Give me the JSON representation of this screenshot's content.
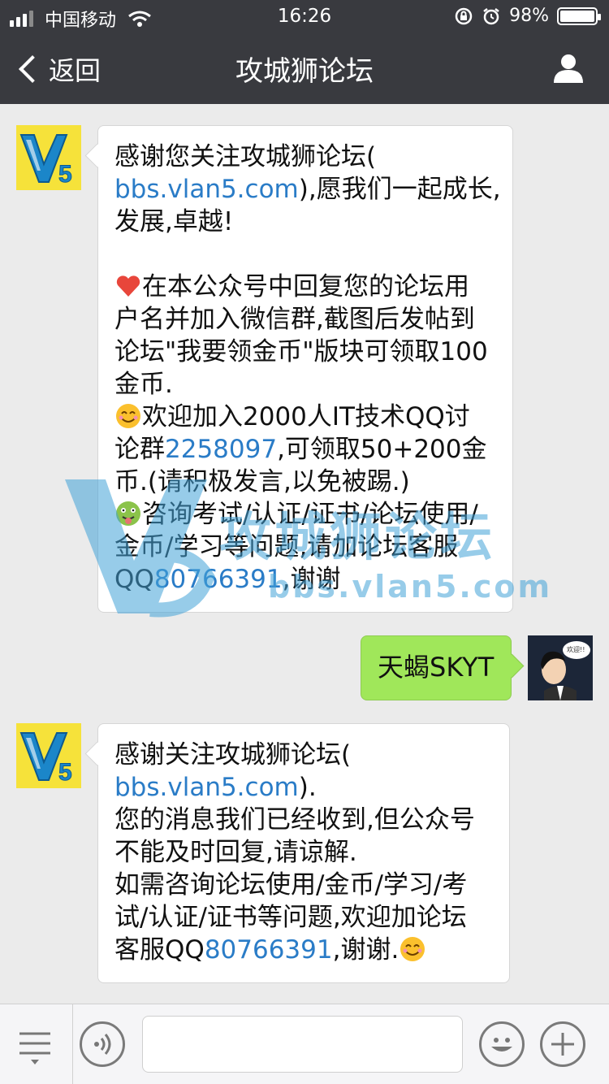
{
  "status_bar": {
    "carrier": "中国移动",
    "time": "16:26",
    "battery": "98%"
  },
  "nav": {
    "back_label": "返回",
    "title": "攻城狮论坛"
  },
  "watermark": {
    "text": "攻城狮论坛",
    "url": "bbs.vlan5.com"
  },
  "messages": [
    {
      "sender": "official",
      "avatar": "V5",
      "lines": [
        [
          "感谢您关注攻城狮论坛("
        ],
        [
          "bbs.vlan5.com",
          "),愿我们一起成长,"
        ],
        [
          "发展,卓越!"
        ],
        [
          ""
        ],
        [
          "在本公众号中回复您的论坛用"
        ],
        [
          "户名并加入微信群,截图后发帖到"
        ],
        [
          "论坛\"我要领金币\"版块可领取100"
        ],
        [
          "金币."
        ],
        [
          "欢迎加入2000人IT技术QQ讨"
        ],
        [
          "论群",
          "2258097",
          ",可领取50+200金"
        ],
        [
          "币.(请积极发言,以免被踢.)"
        ],
        [
          "咨询考试/认证/证书/论坛使用/"
        ],
        [
          "金币/学习等问题,请加论坛客服"
        ],
        [
          "QQ",
          "80766391",
          ",谢谢"
        ]
      ]
    },
    {
      "sender": "user",
      "text": "天蝎SKYT",
      "avatar_bubble": "欢迎!!"
    },
    {
      "sender": "official",
      "avatar": "V5",
      "lines": [
        [
          "感谢关注攻城狮论坛("
        ],
        [
          "bbs.vlan5.com",
          ")."
        ],
        [
          "您的消息我们已经收到,但公众号"
        ],
        [
          "不能及时回复,请谅解."
        ],
        [
          "如需咨询论坛使用/金币/学习/考"
        ],
        [
          "试/认证/证书等问题,欢迎加论坛"
        ],
        [
          "客服QQ",
          "80766391",
          ",谢谢."
        ]
      ]
    }
  ],
  "colors": {
    "nav_bg": "#393a3f",
    "link": "#2a7cc7",
    "my_bubble": "#a0e75a",
    "avatar_bg": "#f6e23a"
  },
  "icons": [
    "signal-icon",
    "wifi-icon",
    "lock-rotation-icon",
    "alarm-icon",
    "battery-icon",
    "back-chevron-icon",
    "profile-icon",
    "menu-icon",
    "voice-icon",
    "emoji-icon",
    "plus-icon",
    "heart-emoji",
    "smile-emoji",
    "tongue-emoji"
  ]
}
